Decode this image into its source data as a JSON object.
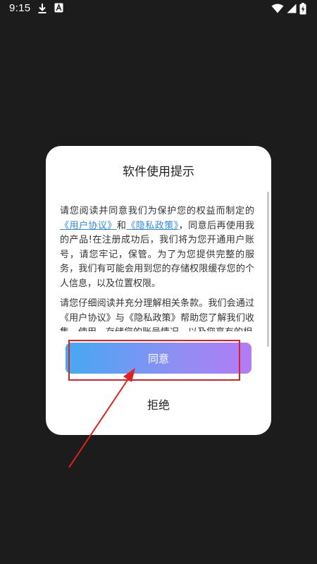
{
  "status_bar": {
    "time": "9:15",
    "icons": [
      "download-icon",
      "app-notification-icon",
      "wifi-icon",
      "signal-icon",
      "battery-charging-icon"
    ]
  },
  "dialog": {
    "title": "软件使用提示",
    "paragraph1": {
      "part1": "请您阅读并同意我们为保护您的权益而制定的",
      "link_user_agreement": "《用户协议》",
      "and": "和",
      "link_privacy_policy": "《隐私政策》",
      "part2": "，同意后再使用我的产品!在注册成功后，我们将为您开通用户账号，请您牢记，保管。为了为您提供完整的服务，我们有可能会用到您的存储权限缓存您的个人信息，以及位置权限。"
    },
    "paragraph2": "请您仔细阅读并充分理解相关条款。我们会通过《用户协议》与《隐私政策》帮助您了解我们收集、使用、存储您的账号情况，以及您享有的相",
    "agree_label": "同意",
    "refuse_label": "拒绝"
  },
  "colors": {
    "background": "#1c1c1c",
    "dialog": "#ffffff",
    "link": "#2f8ae8",
    "button_gradient_start": "#44a9f3",
    "button_gradient_end": "#b27cf4",
    "annotation": "#e02020"
  }
}
